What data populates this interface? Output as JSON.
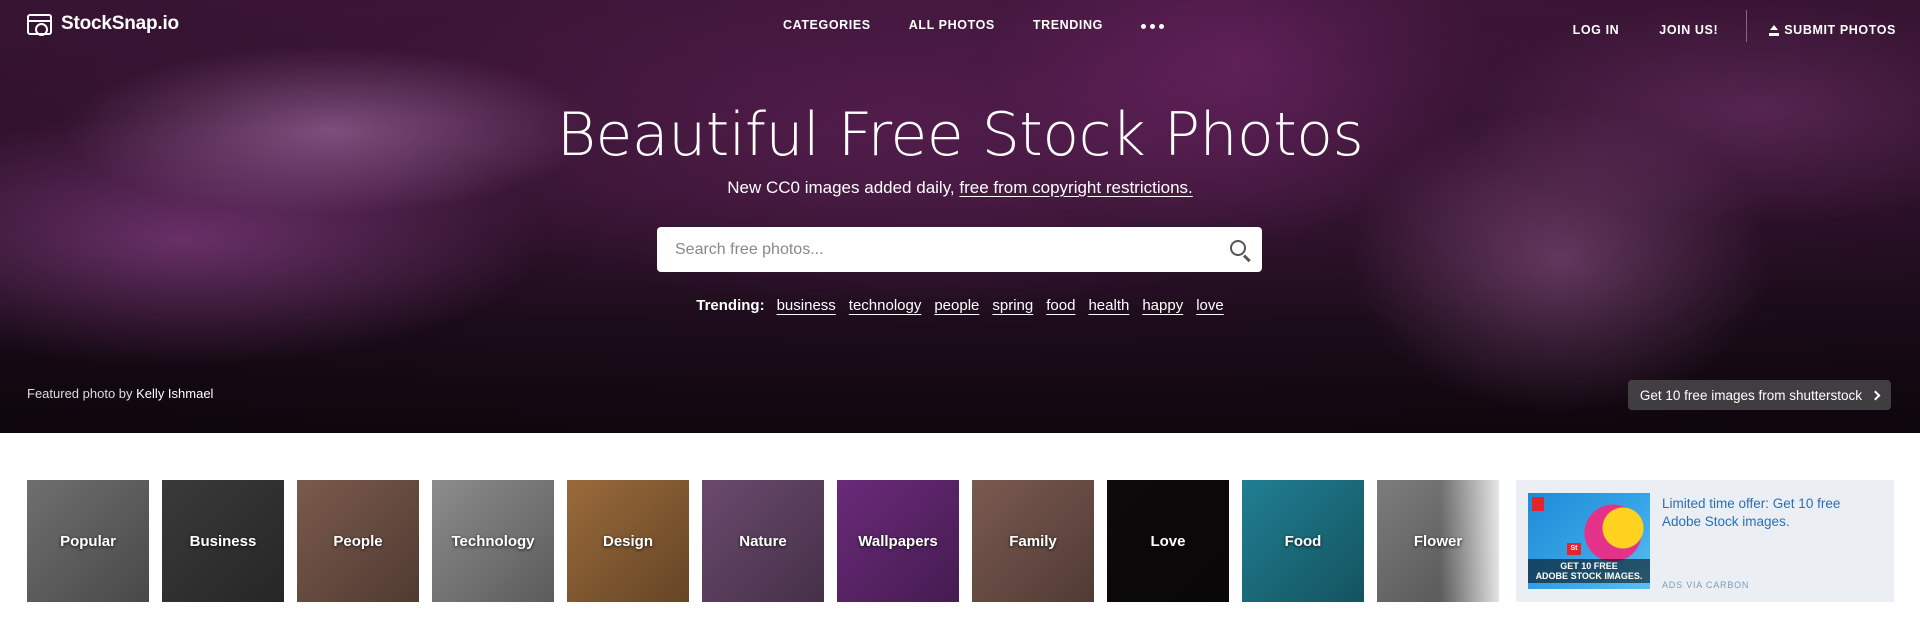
{
  "brand": {
    "name": "StockSnap.io"
  },
  "nav": {
    "center": [
      "CATEGORIES",
      "ALL PHOTOS",
      "TRENDING"
    ],
    "more_icon": "ellipsis-icon",
    "login": "LOG IN",
    "join": "JOIN US!",
    "submit": "SUBMIT PHOTOS",
    "submit_icon": "upload-icon"
  },
  "hero": {
    "title": "Beautiful Free Stock Photos",
    "subtitle_prefix": "New CC0 images added daily, ",
    "subtitle_link": "free from copyright restrictions.",
    "search_placeholder": "Search free photos...",
    "search_icon": "search-icon",
    "trending_label": "Trending:",
    "trending_tags": [
      "business",
      "technology",
      "people",
      "spring",
      "food",
      "health",
      "happy",
      "love"
    ],
    "credit_prefix": "Featured photo by ",
    "credit_author": "Kelly Ishmael",
    "promo": "Get 10 free images from shutterstock",
    "promo_icon": "chevron-right-icon"
  },
  "categories": [
    {
      "label": "Popular",
      "color": "#6f6f6f"
    },
    {
      "label": "Business",
      "color": "#3a3a3a"
    },
    {
      "label": "People",
      "color": "#7a5a4c"
    },
    {
      "label": "Technology",
      "color": "#8c8c8c"
    },
    {
      "label": "Design",
      "color": "#9a6a3a"
    },
    {
      "label": "Nature",
      "color": "#6a4a6e"
    },
    {
      "label": "Wallpapers",
      "color": "#6a2a7a"
    },
    {
      "label": "Family",
      "color": "#7a5a50"
    },
    {
      "label": "Love",
      "color": "#0e0a0c"
    },
    {
      "label": "Food",
      "color": "#1f7f92"
    },
    {
      "label": "Flower",
      "color": "#7c7c7c"
    }
  ],
  "ad": {
    "image_text_1": "GET 10 FREE",
    "image_text_2": "ADOBE STOCK IMAGES.",
    "image_badge": "St",
    "text": "Limited time offer: Get 10 free Adobe Stock images.",
    "via": "ADS VIA CARBON"
  }
}
